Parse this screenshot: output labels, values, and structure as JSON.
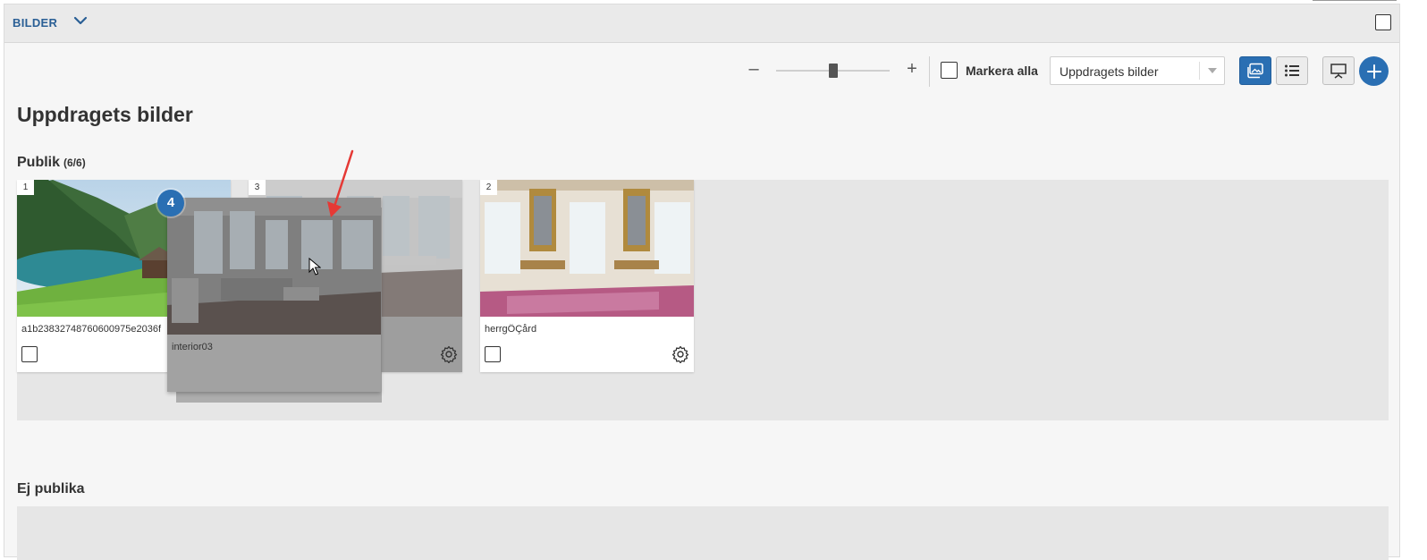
{
  "header": {
    "title": "BILDER"
  },
  "toolbar": {
    "zoom_minus": "–",
    "zoom_plus": "+",
    "mark_all_label": "Markera alla",
    "select_value": "Uppdragets bilder"
  },
  "page": {
    "title": "Uppdragets bilder"
  },
  "sections": {
    "public": {
      "title": "Publik",
      "count": "(6/6)"
    },
    "private": {
      "title": "Ej publika"
    }
  },
  "cards": [
    {
      "number": "1",
      "filename": "a1b23832748760600975e2036f",
      "image": "mountain-lake-icon"
    },
    {
      "number": "3",
      "filename": "",
      "image": "interior-room-icon"
    },
    {
      "number": "2",
      "filename": "herrgÔÇård",
      "image": "manor-hall-icon"
    }
  ],
  "drag": {
    "badge": "4",
    "filename": "interior03"
  },
  "colors": {
    "accent": "#2a6fb3",
    "dropzone": "#e6e6e6",
    "annotation": "#e53935"
  }
}
